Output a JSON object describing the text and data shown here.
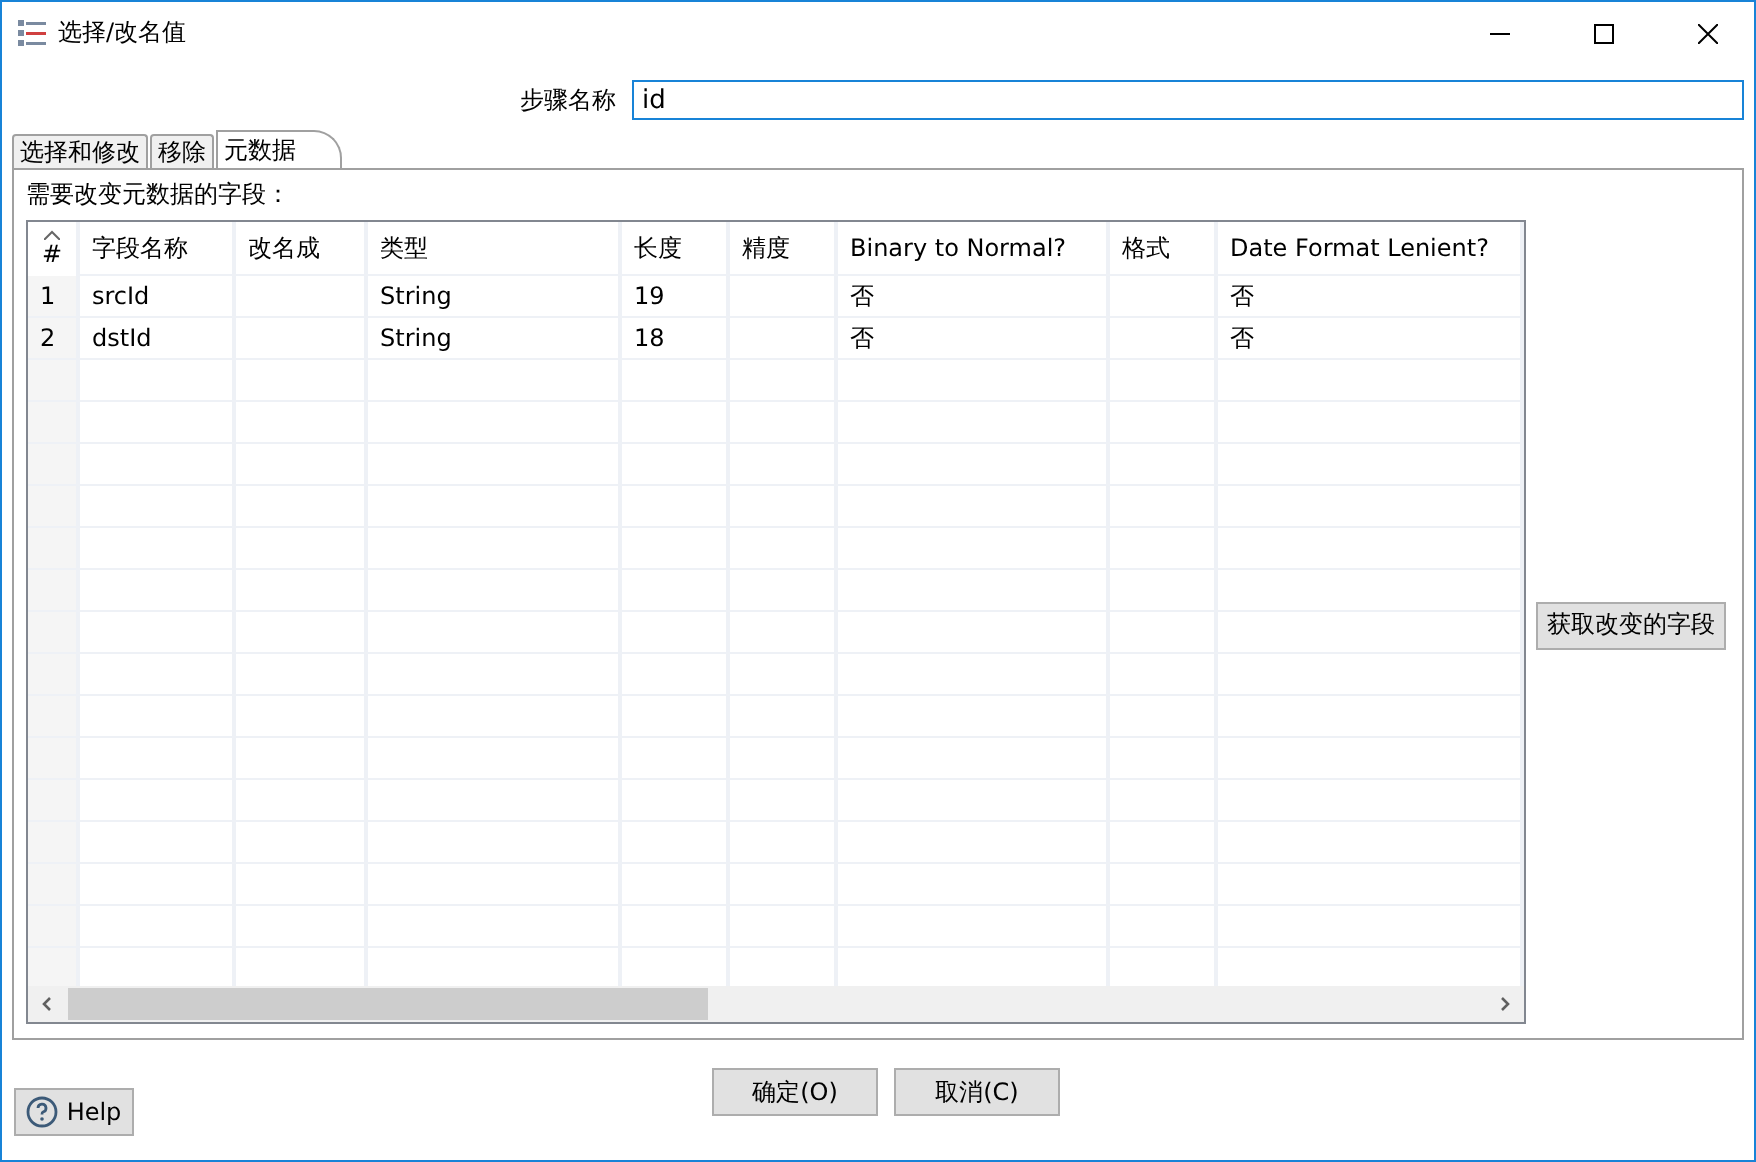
{
  "window": {
    "title": "选择/改名值"
  },
  "step_name": {
    "label": "步骤名称",
    "value": "id"
  },
  "tabs": [
    {
      "label": "选择和修改",
      "selected": false
    },
    {
      "label": "移除",
      "selected": false
    },
    {
      "label": "元数据",
      "selected": true
    }
  ],
  "section_label": "需要改变元数据的字段：",
  "table": {
    "columns": [
      "#",
      "字段名称",
      "改名成",
      "类型",
      "长度",
      "精度",
      "Binary to Normal?",
      "格式",
      "Date Format Lenient?"
    ],
    "rows": [
      [
        "1",
        "srcId",
        "",
        "String",
        "19",
        "",
        "否",
        "",
        "否"
      ],
      [
        "2",
        "dstId",
        "",
        "String",
        "18",
        "",
        "否",
        "",
        "否"
      ]
    ]
  },
  "side_button": "获取改变的字段",
  "buttons": [
    "确定(O)",
    "取消(C)"
  ],
  "help": "Help"
}
